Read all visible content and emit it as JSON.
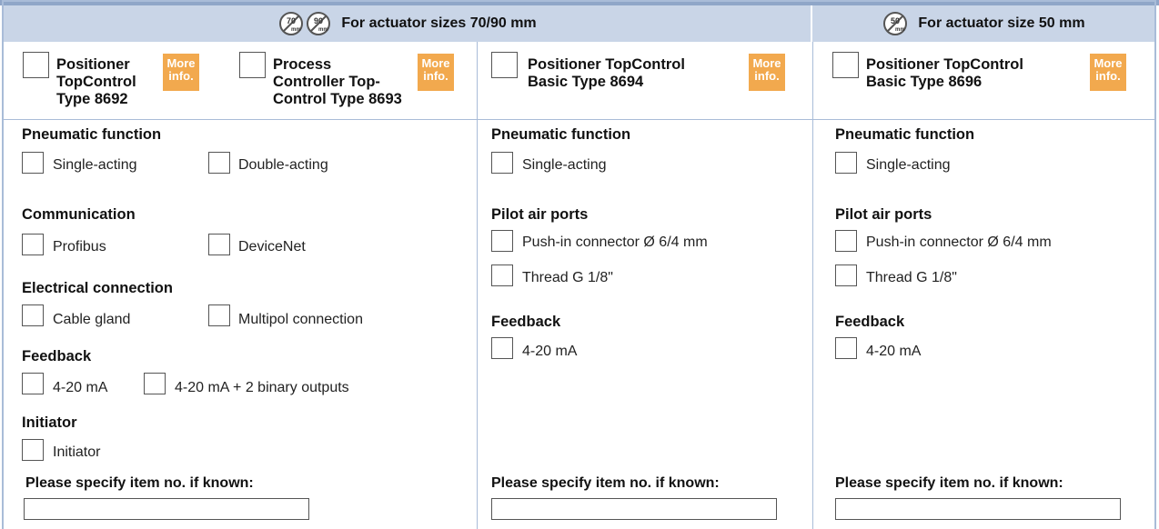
{
  "headers": {
    "a": {
      "text": "For actuator sizes 70/90 mm",
      "icons": [
        "70",
        "90"
      ],
      "icon_sub": "mm"
    },
    "b": {
      "text": "For actuator size 50 mm",
      "icons": [
        "50"
      ],
      "icon_sub": "mm"
    }
  },
  "more_label": [
    "More",
    "info."
  ],
  "colors": {
    "header_bg": "#c9d5e7",
    "rule": "#a9bcd8",
    "more_bg": "#f2a94e"
  },
  "products": {
    "p8692": [
      "Positioner",
      "TopControl",
      "Type 8692"
    ],
    "p8693": [
      "Process",
      "Controller Top-",
      "Control Type 8693"
    ],
    "p8694": [
      "Positioner TopControl",
      "Basic Type 8694"
    ],
    "p8696": [
      "Positioner TopControl",
      "Basic Type 8696"
    ]
  },
  "col1": {
    "pneumatic": {
      "title": "Pneumatic function",
      "options": [
        "Single-acting",
        "Double-acting"
      ]
    },
    "communication": {
      "title": "Communication",
      "options": [
        "Profibus",
        "DeviceNet"
      ]
    },
    "electrical": {
      "title": "Electrical connection",
      "options": [
        "Cable gland",
        "Multipol connection"
      ]
    },
    "feedback": {
      "title": "Feedback",
      "options": [
        "4-20 mA",
        "4-20 mA + 2 binary outputs"
      ]
    },
    "initiator": {
      "title": "Initiator",
      "options": [
        "Initiator"
      ]
    },
    "specify": "Please specify item no. if known:"
  },
  "col2": {
    "pneumatic": {
      "title": "Pneumatic function",
      "options": [
        "Single-acting"
      ]
    },
    "pilot": {
      "title": "Pilot air ports",
      "options": [
        "Push-in connector Ø 6/4 mm",
        "Thread G 1/8\""
      ]
    },
    "feedback": {
      "title": "Feedback",
      "options": [
        "4-20 mA"
      ]
    },
    "specify": "Please specify item no. if known:"
  },
  "col3": {
    "pneumatic": {
      "title": "Pneumatic function",
      "options": [
        "Single-acting"
      ]
    },
    "pilot": {
      "title": "Pilot air ports",
      "options": [
        "Push-in connector Ø 6/4 mm",
        "Thread G 1/8\""
      ]
    },
    "feedback": {
      "title": "Feedback",
      "options": [
        "4-20 mA"
      ]
    },
    "specify": "Please specify item no. if known:"
  }
}
